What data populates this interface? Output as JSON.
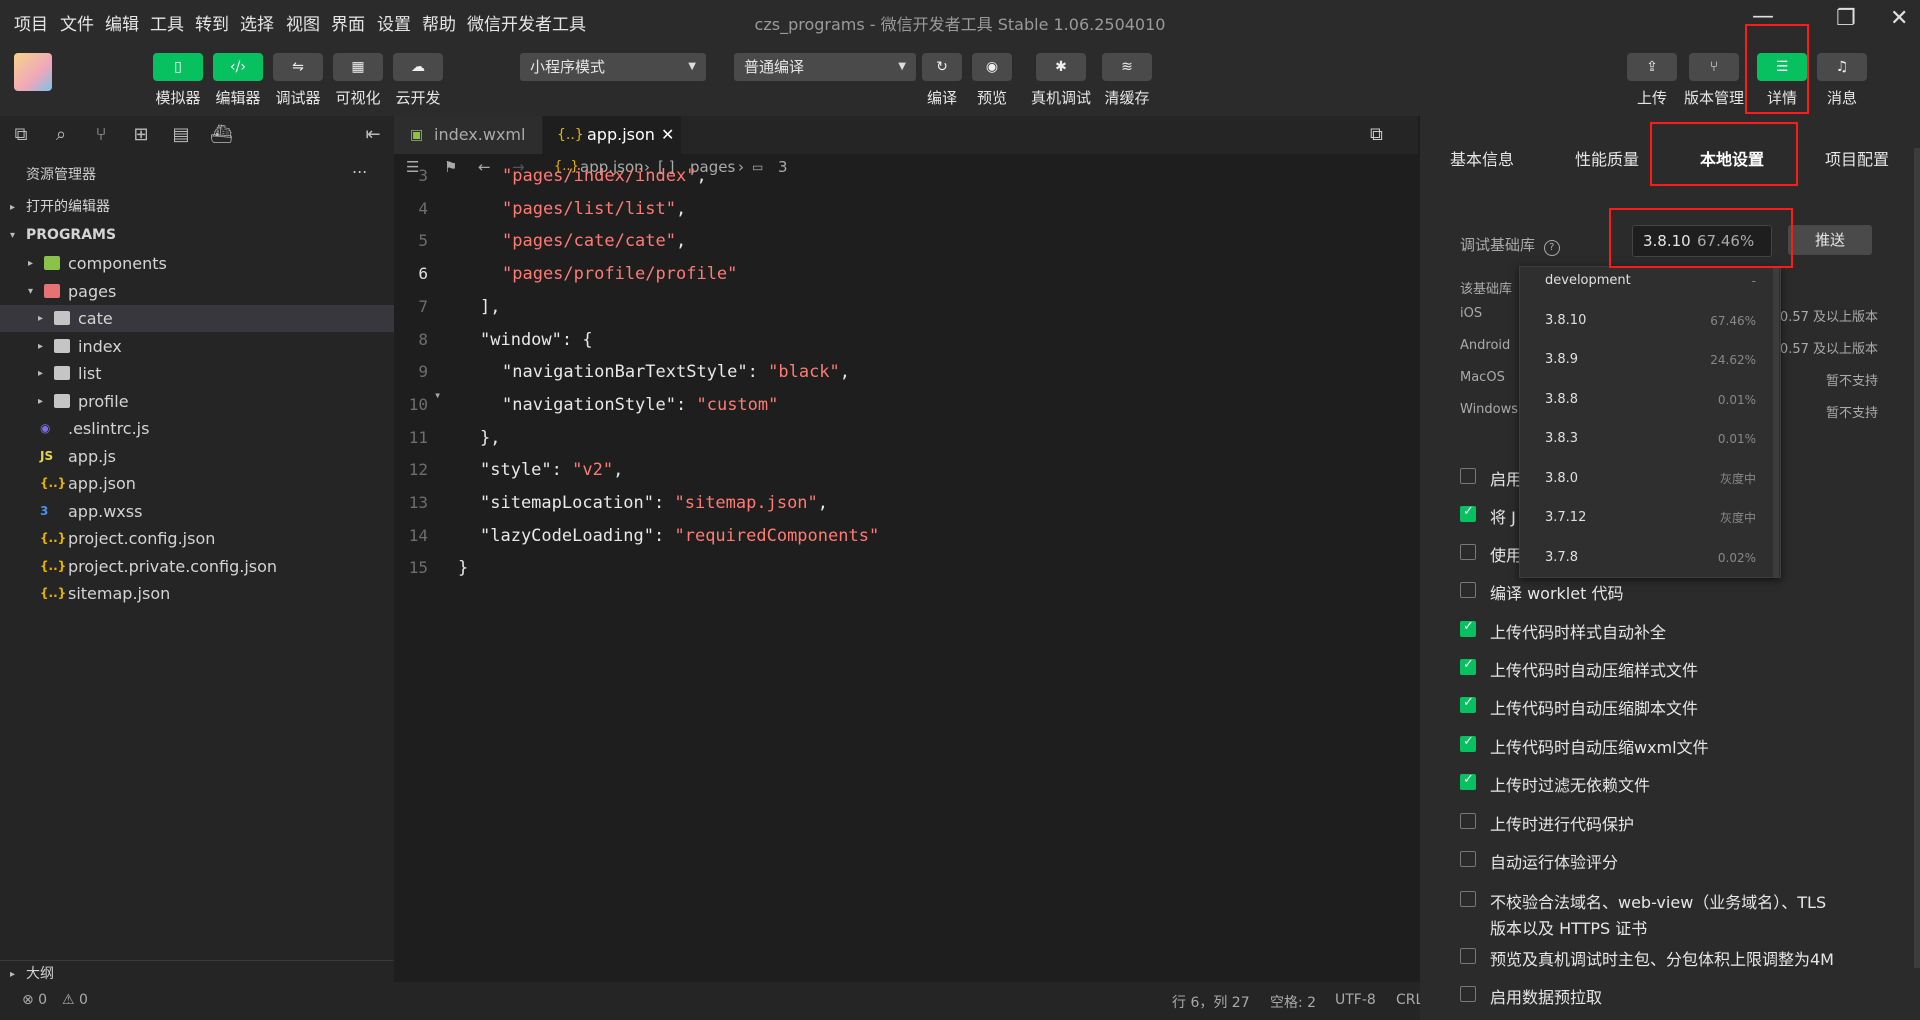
{
  "menubar": {
    "items": [
      "项目",
      "文件",
      "编辑",
      "工具",
      "转到",
      "选择",
      "视图",
      "界面",
      "设置",
      "帮助",
      "微信开发者工具"
    ],
    "title": "czs_programs - 微信开发者工具 Stable 1.06.2504010"
  },
  "toolbar": {
    "left_buttons": [
      {
        "label": "模拟器",
        "icon": "phone-icon"
      },
      {
        "label": "编辑器",
        "icon": "code-icon"
      },
      {
        "label": "调试器",
        "icon": "debug-icon"
      },
      {
        "label": "可视化",
        "icon": "layout-icon"
      },
      {
        "label": "云开发",
        "icon": "cloud-icon"
      }
    ],
    "mode_select": "小程序模式",
    "compile_select": "普通编译",
    "mid_buttons": [
      {
        "label": "编译",
        "icon": "refresh-icon"
      },
      {
        "label": "预览",
        "icon": "eye-icon"
      },
      {
        "label": "真机调试",
        "icon": "bug-icon"
      },
      {
        "label": "清缓存",
        "icon": "layers-icon"
      }
    ],
    "right_buttons": [
      {
        "label": "上传",
        "icon": "upload-icon"
      },
      {
        "label": "版本管理",
        "icon": "branch-icon"
      },
      {
        "label": "详情",
        "icon": "menu-icon"
      },
      {
        "label": "消息",
        "icon": "bell-icon"
      }
    ]
  },
  "sidebar": {
    "title": "资源管理器",
    "more": "...",
    "open_editors": "打开的编辑器",
    "project": "PROGRAMS",
    "tree": [
      {
        "label": "components",
        "type": "folder-green",
        "depth": 1,
        "arrow": "▸"
      },
      {
        "label": "pages",
        "type": "folder-red",
        "depth": 1,
        "arrow": "▾"
      },
      {
        "label": "cate",
        "type": "folder",
        "depth": 2,
        "arrow": "▸"
      },
      {
        "label": "index",
        "type": "folder",
        "depth": 2,
        "arrow": "▸"
      },
      {
        "label": "list",
        "type": "folder",
        "depth": 2,
        "arrow": "▸"
      },
      {
        "label": "profile",
        "type": "folder",
        "depth": 2,
        "arrow": "▸"
      },
      {
        "label": ".eslintrc.js",
        "type": "eslint",
        "depth": 1,
        "arrow": ""
      },
      {
        "label": "app.js",
        "type": "js",
        "depth": 1,
        "arrow": ""
      },
      {
        "label": "app.json",
        "type": "json",
        "depth": 1,
        "arrow": ""
      },
      {
        "label": "app.wxss",
        "type": "css",
        "depth": 1,
        "arrow": ""
      },
      {
        "label": "project.config.json",
        "type": "json",
        "depth": 1,
        "arrow": ""
      },
      {
        "label": "project.private.config.json",
        "type": "json",
        "depth": 1,
        "arrow": ""
      },
      {
        "label": "sitemap.json",
        "type": "json",
        "depth": 1,
        "arrow": ""
      }
    ],
    "outline": "大纲"
  },
  "editor": {
    "tabs": [
      {
        "label": "index.wxml",
        "active": false
      },
      {
        "label": "app.json",
        "active": true
      }
    ],
    "breadcrumb": [
      "app.json",
      "pages",
      "3"
    ],
    "lines": [
      {
        "n": "3",
        "tokens": [
          {
            "t": "\"pages/index/index\"",
            "c": "str"
          },
          {
            "t": ",",
            "c": "pun"
          }
        ],
        "indent": 2
      },
      {
        "n": "4",
        "tokens": [
          {
            "t": "\"pages/list/list\"",
            "c": "str"
          },
          {
            "t": ",",
            "c": "pun"
          }
        ],
        "indent": 2
      },
      {
        "n": "5",
        "tokens": [
          {
            "t": "\"pages/cate/cate\"",
            "c": "str"
          },
          {
            "t": ",",
            "c": "pun"
          }
        ],
        "indent": 2
      },
      {
        "n": "6",
        "tokens": [
          {
            "t": "\"pages/profile/profile\"",
            "c": "str"
          }
        ],
        "indent": 2
      },
      {
        "n": "7",
        "tokens": [
          {
            "t": "],",
            "c": "pun"
          }
        ],
        "indent": 1
      },
      {
        "n": "8",
        "tokens": [
          {
            "t": "\"window\"",
            "c": "key"
          },
          {
            "t": ": {",
            "c": "pun"
          }
        ],
        "indent": 1
      },
      {
        "n": "9",
        "tokens": [
          {
            "t": "\"navigationBarTextStyle\"",
            "c": "key"
          },
          {
            "t": ": ",
            "c": "pun"
          },
          {
            "t": "\"black\"",
            "c": "str"
          },
          {
            "t": ",",
            "c": "pun"
          }
        ],
        "indent": 2
      },
      {
        "n": "10",
        "tokens": [
          {
            "t": "\"navigationStyle\"",
            "c": "key"
          },
          {
            "t": ": ",
            "c": "pun"
          },
          {
            "t": "\"custom\"",
            "c": "str"
          }
        ],
        "indent": 2
      },
      {
        "n": "11",
        "tokens": [
          {
            "t": "},",
            "c": "pun"
          }
        ],
        "indent": 1
      },
      {
        "n": "12",
        "tokens": [
          {
            "t": "\"style\"",
            "c": "key"
          },
          {
            "t": ": ",
            "c": "pun"
          },
          {
            "t": "\"v2\"",
            "c": "str"
          },
          {
            "t": ",",
            "c": "pun"
          }
        ],
        "indent": 1
      },
      {
        "n": "13",
        "tokens": [
          {
            "t": "\"sitemapLocation\"",
            "c": "key"
          },
          {
            "t": ": ",
            "c": "pun"
          },
          {
            "t": "\"sitemap.json\"",
            "c": "str"
          },
          {
            "t": ",",
            "c": "pun"
          }
        ],
        "indent": 1
      },
      {
        "n": "14",
        "tokens": [
          {
            "t": "\"lazyCodeLoading\"",
            "c": "key"
          },
          {
            "t": ": ",
            "c": "pun"
          },
          {
            "t": "\"requiredComponents\"",
            "c": "str"
          }
        ],
        "indent": 1
      },
      {
        "n": "15",
        "tokens": [
          {
            "t": "}",
            "c": "pun"
          }
        ],
        "indent": 0
      }
    ],
    "current_line": "6"
  },
  "statusbar": {
    "errors": "⊗ 0",
    "warnings": "⚠ 0",
    "position": "行 6，列 27",
    "spaces": "空格: 2",
    "encoding": "UTF-8",
    "eol": "CRL"
  },
  "details": {
    "tabs": [
      "基本信息",
      "性能质量",
      "本地设置",
      "项目配置"
    ],
    "active_tab": "本地设置",
    "lib_label": "调试基础库",
    "lib_version": "3.8.10",
    "lib_percent": "67.46%",
    "push_button": "推送",
    "lib_note": "该基础库",
    "platforms": [
      {
        "name": "iOS",
        "value": "0.57 及以上版本"
      },
      {
        "name": "Android",
        "value": "0.57 及以上版本"
      },
      {
        "name": "MacOS",
        "value": "暂不支持"
      },
      {
        "name": "Windows",
        "value": "暂不支持"
      }
    ],
    "dropdown": [
      {
        "version": "development",
        "percent": "-"
      },
      {
        "version": "3.8.10",
        "percent": "67.46%"
      },
      {
        "version": "3.8.9",
        "percent": "24.62%"
      },
      {
        "version": "3.8.8",
        "percent": "0.01%"
      },
      {
        "version": "3.8.3",
        "percent": "0.01%"
      },
      {
        "version": "3.8.0",
        "percent": "灰度中"
      },
      {
        "version": "3.7.12",
        "percent": "灰度中"
      },
      {
        "version": "3.7.8",
        "percent": "0.02%"
      }
    ],
    "checkboxes": [
      {
        "label": "启用",
        "checked": false
      },
      {
        "label": "将 J",
        "checked": true
      },
      {
        "label": "使用",
        "checked": false
      },
      {
        "label": "编译 worklet 代码",
        "checked": false
      },
      {
        "label": "上传代码时样式自动补全",
        "checked": true
      },
      {
        "label": "上传代码时自动压缩样式文件",
        "checked": true
      },
      {
        "label": "上传代码时自动压缩脚本文件",
        "checked": true
      },
      {
        "label": "上传代码时自动压缩wxml文件",
        "checked": true
      },
      {
        "label": "上传时过滤无依赖文件",
        "checked": true
      },
      {
        "label": "上传时进行代码保护",
        "checked": false
      },
      {
        "label": "自动运行体验评分",
        "checked": false
      },
      {
        "label": "不校验合法域名、web-view（业务域名）、TLS",
        "label2": "版本以及 HTTPS 证书",
        "checked": false
      },
      {
        "label": "预览及真机调试时主包、分包体积上限调整为4M",
        "checked": false
      },
      {
        "label": "启用数据预拉取",
        "checked": false
      }
    ]
  },
  "colors": {
    "accent": "#07c160",
    "highlight": "#ff1a1a",
    "string": "#ff7b72"
  }
}
